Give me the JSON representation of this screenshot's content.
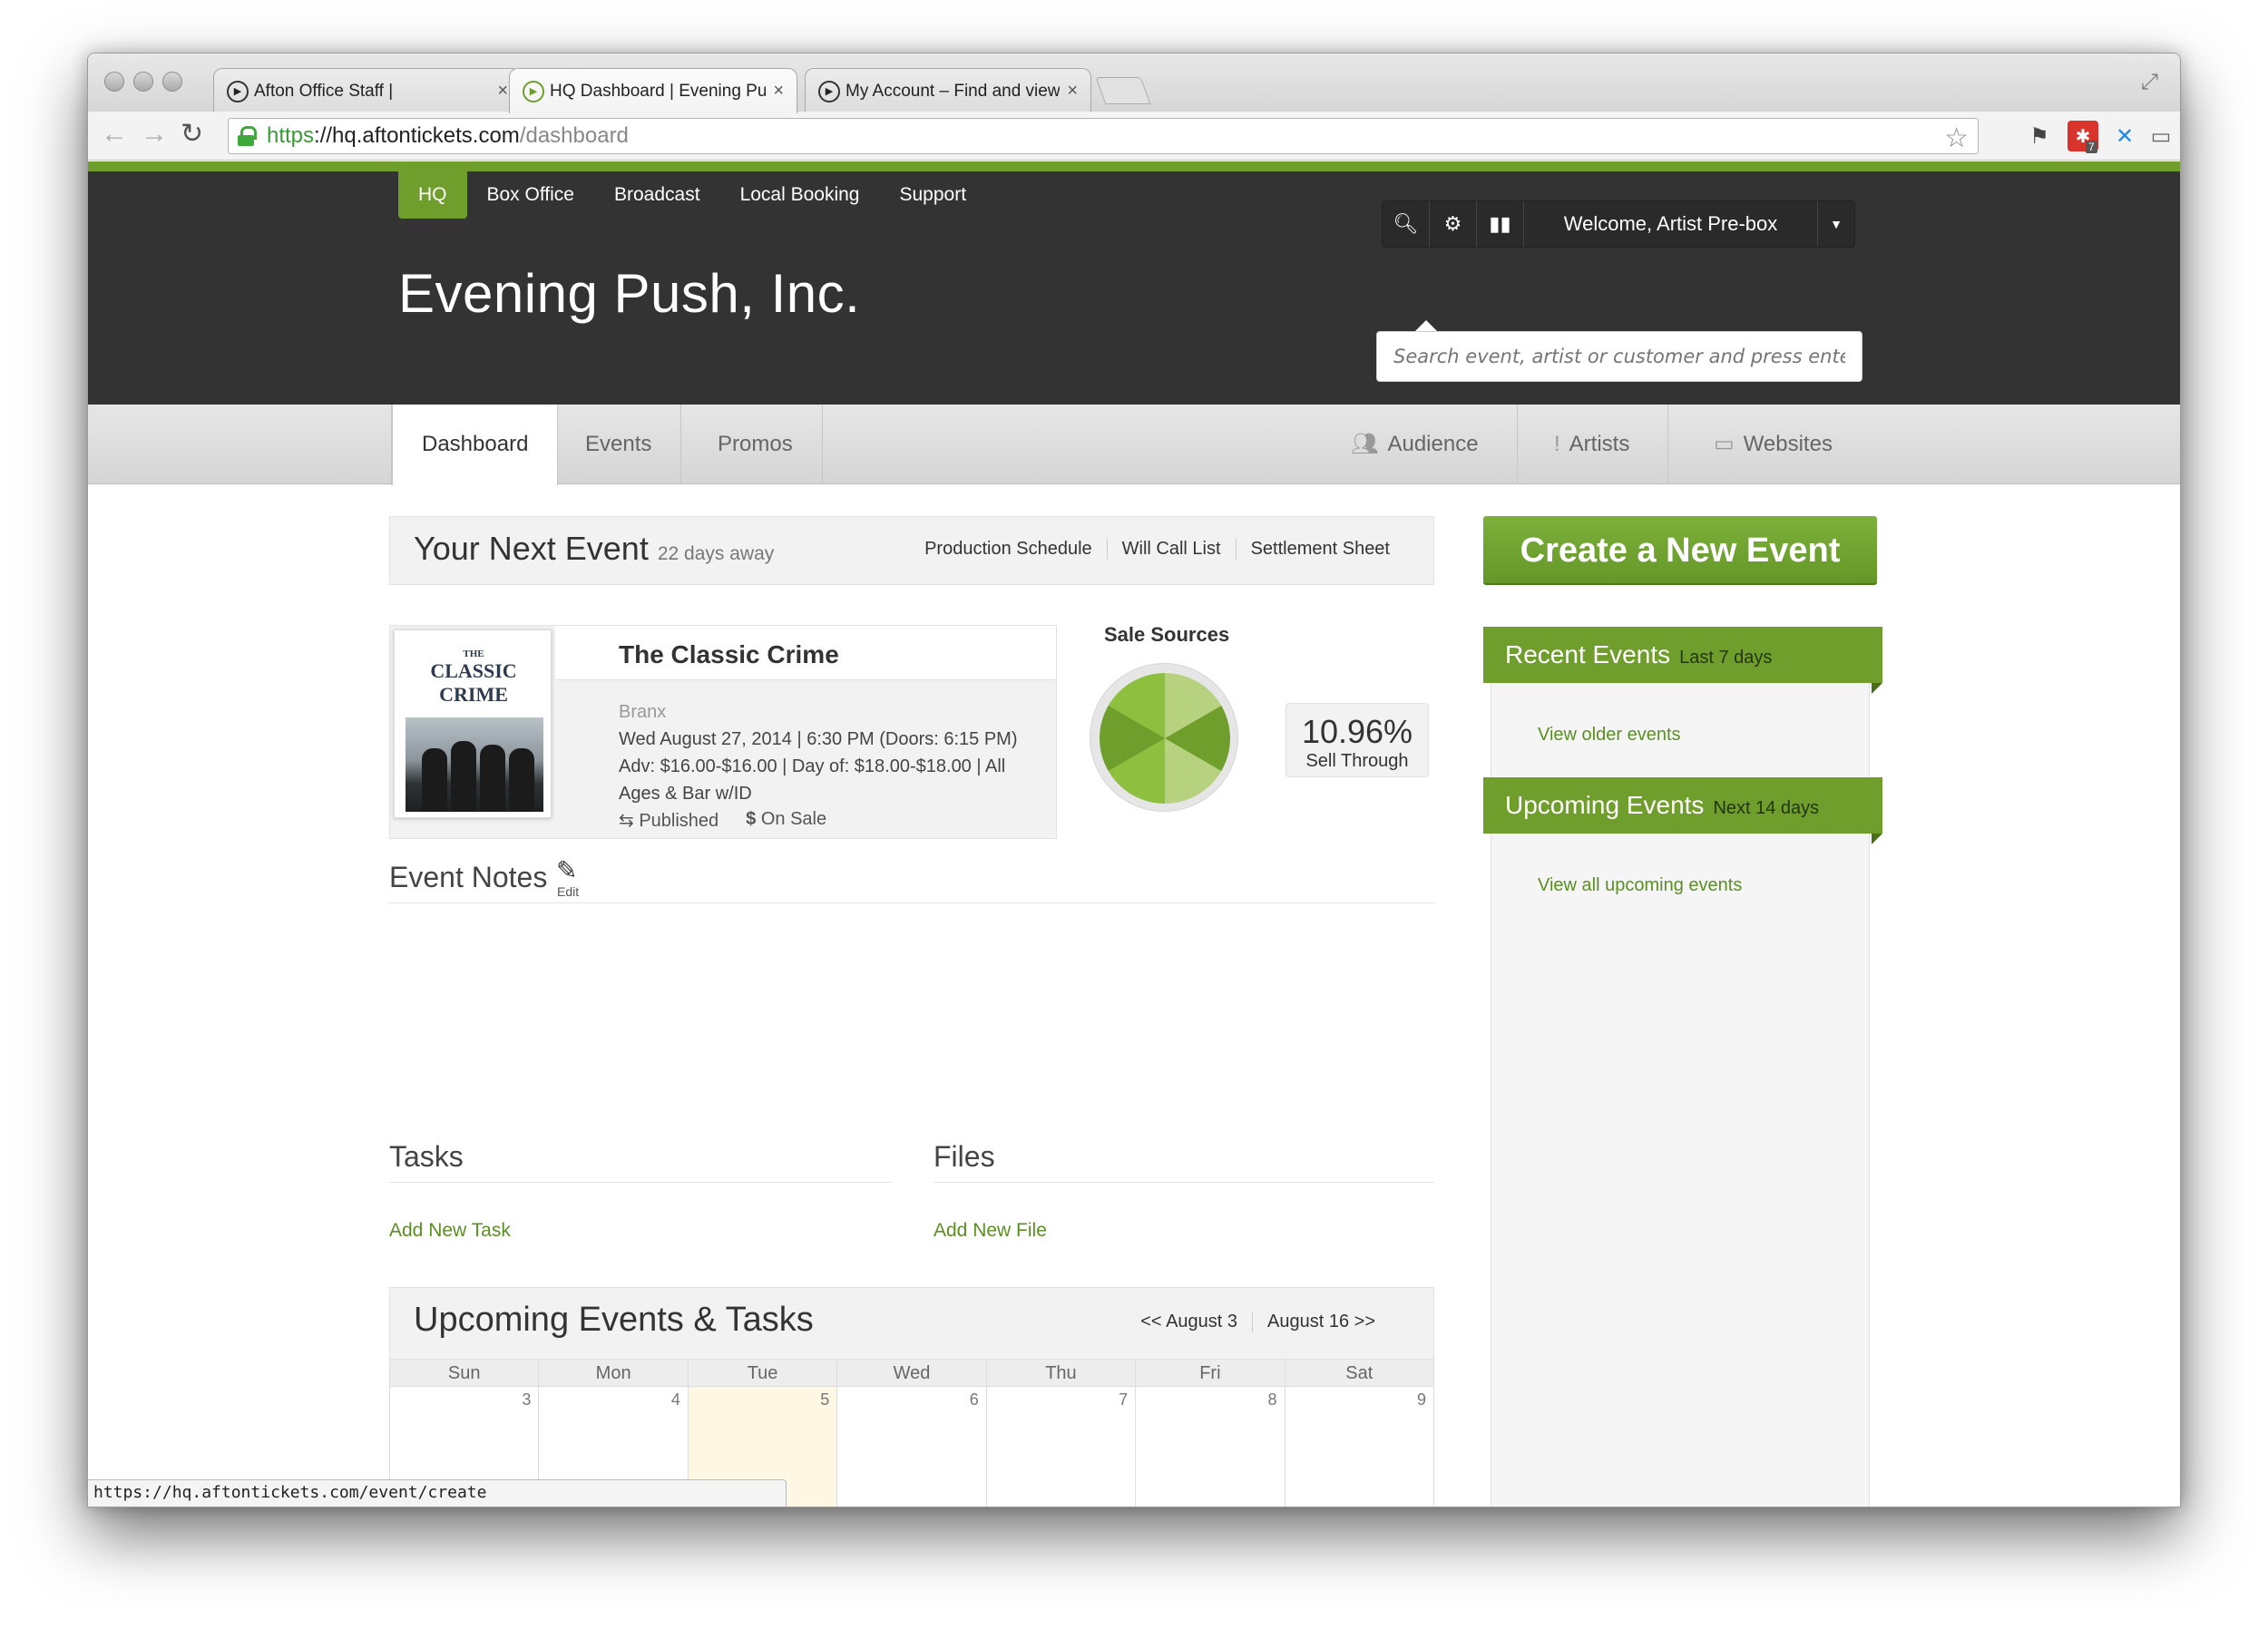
{
  "browser": {
    "tabs": [
      {
        "title": "Afton Office Staff |",
        "close": "×"
      },
      {
        "title": "HQ Dashboard | Evening Pu",
        "close": "×"
      },
      {
        "title": "My Account – Find and view",
        "close": "×"
      }
    ],
    "url": {
      "scheme": "https",
      "host": "://hq.aftontickets.com",
      "path": "/dashboard"
    },
    "status_url": "https://hq.aftontickets.com/event/create",
    "extension_badge": "7"
  },
  "header": {
    "nav": [
      "HQ",
      "Box Office",
      "Broadcast",
      "Local Booking",
      "Support"
    ],
    "brand": "Evening Push, Inc.",
    "welcome": "Welcome, Artist Pre-box",
    "search_placeholder": "Search event, artist or customer and press enter"
  },
  "subnav": {
    "tabs": [
      "Dashboard",
      "Events",
      "Promos"
    ],
    "right": [
      "Audience",
      "Artists",
      "Websites"
    ]
  },
  "next_event": {
    "title": "Your Next Event",
    "away": "22 days away",
    "links": [
      "Production Schedule",
      "Will Call List",
      "Settlement Sheet"
    ],
    "poster_title_small": "THE",
    "poster_title": "CLASSIC CRIME",
    "name": "The Classic Crime",
    "venue": "Branx",
    "datetime": "Wed August 27, 2014 | 6:30 PM (Doors: 6:15 PM)",
    "price_line1": "Adv: $16.00-$16.00  | Day of: $18.00-$18.00 | All",
    "price_line2": "Ages & Bar w/ID",
    "published": "Published",
    "on_sale": "On Sale"
  },
  "sales": {
    "title": "Sale Sources",
    "sell_through_pct": "10.96%",
    "sell_through_label": "Sell Through",
    "colors": [
      "#b7d27f",
      "#6f9e2c",
      "#8ebf3f"
    ]
  },
  "notes": {
    "title": "Event Notes",
    "edit": "Edit"
  },
  "tasks": {
    "title": "Tasks",
    "add": "Add New Task"
  },
  "files": {
    "title": "Files",
    "add": "Add New File"
  },
  "upcoming": {
    "title": "Upcoming Events & Tasks",
    "prev": "<< August 3",
    "next": "August 16 >>",
    "days": [
      {
        "name": "Sun",
        "num": "3"
      },
      {
        "name": "Mon",
        "num": "4"
      },
      {
        "name": "Tue",
        "num": "5"
      },
      {
        "name": "Wed",
        "num": "6"
      },
      {
        "name": "Thu",
        "num": "7"
      },
      {
        "name": "Fri",
        "num": "8"
      },
      {
        "name": "Sat",
        "num": "9"
      }
    ]
  },
  "sidebar": {
    "create": "Create a New Event",
    "recent_title": "Recent Events",
    "recent_range": "Last 7 days",
    "recent_link": "View older events",
    "upcoming_title": "Upcoming Events",
    "upcoming_range": "Next 14 days",
    "upcoming_link": "View all upcoming events"
  },
  "accent_color": "#6f9e2c"
}
